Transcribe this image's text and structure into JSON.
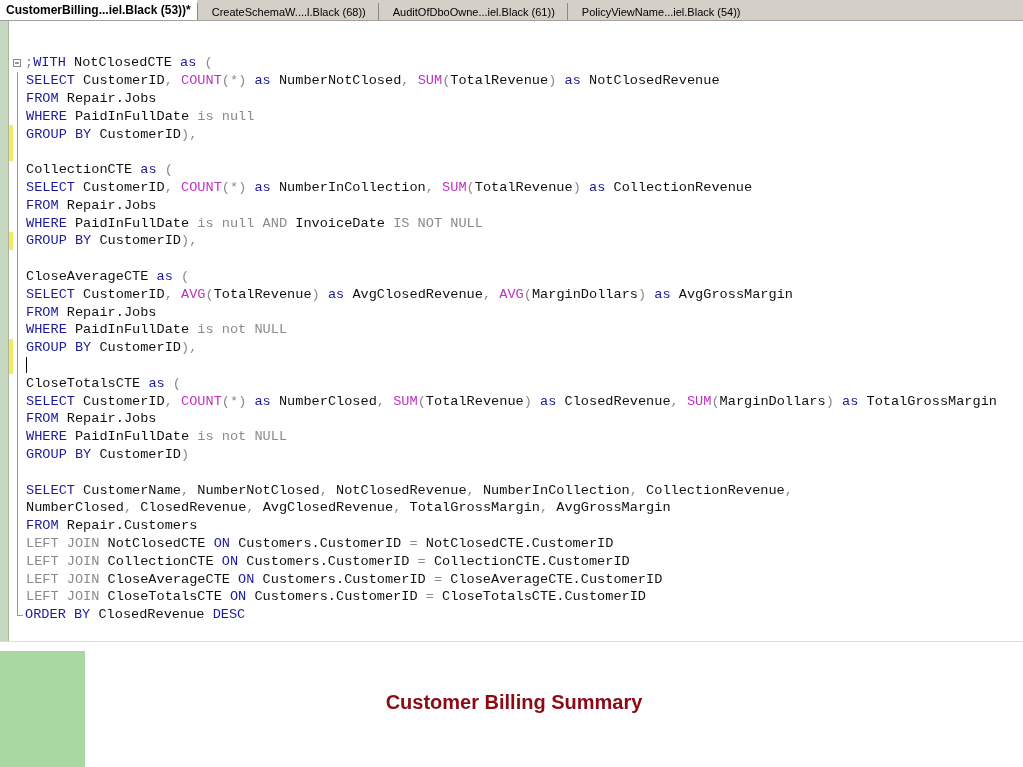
{
  "tabs": [
    {
      "label": "CustomerBilling...iel.Black (53))*",
      "selected": true
    },
    {
      "label": "CreateSchemaW....l.Black (68))",
      "selected": false
    },
    {
      "label": "AuditOfDboOwne...iel.Black (61))",
      "selected": false
    },
    {
      "label": "PolicyViewName...iel.Black (54))",
      "selected": false
    }
  ],
  "editor": {
    "lines": [
      {
        "tokens": [
          {
            "kind": "op",
            "text": ";"
          },
          {
            "kind": "kw",
            "text": "WITH"
          },
          {
            "kind": "plain",
            "text": " NotClosedCTE "
          },
          {
            "kind": "kw",
            "text": "as"
          },
          {
            "kind": "op",
            "text": " ("
          }
        ],
        "changed": false,
        "cursor": false
      },
      {
        "tokens": [
          {
            "kind": "kw",
            "text": "SELECT"
          },
          {
            "kind": "plain",
            "text": " CustomerID"
          },
          {
            "kind": "op",
            "text": ", "
          },
          {
            "kind": "fn",
            "text": "COUNT"
          },
          {
            "kind": "op",
            "text": "(*) "
          },
          {
            "kind": "kw",
            "text": "as"
          },
          {
            "kind": "plain",
            "text": " NumberNotClosed"
          },
          {
            "kind": "op",
            "text": ", "
          },
          {
            "kind": "fn",
            "text": "SUM"
          },
          {
            "kind": "op",
            "text": "("
          },
          {
            "kind": "plain",
            "text": "TotalRevenue"
          },
          {
            "kind": "op",
            "text": ") "
          },
          {
            "kind": "kw",
            "text": "as"
          },
          {
            "kind": "plain",
            "text": " NotClosedRevenue"
          }
        ],
        "changed": false,
        "cursor": false
      },
      {
        "tokens": [
          {
            "kind": "kw",
            "text": "FROM"
          },
          {
            "kind": "plain",
            "text": " Repair.Jobs"
          }
        ],
        "changed": false,
        "cursor": false
      },
      {
        "tokens": [
          {
            "kind": "kw",
            "text": "WHERE"
          },
          {
            "kind": "plain",
            "text": " PaidInFullDate "
          },
          {
            "kind": "op",
            "text": "is null"
          }
        ],
        "changed": false,
        "cursor": false
      },
      {
        "tokens": [
          {
            "kind": "kw",
            "text": "GROUP BY"
          },
          {
            "kind": "plain",
            "text": " CustomerID"
          },
          {
            "kind": "op",
            "text": "),"
          }
        ],
        "changed": true,
        "cursor": false
      },
      {
        "changed": true,
        "cursor": false
      },
      {
        "tokens": [
          {
            "kind": "plain",
            "text": "CollectionCTE "
          },
          {
            "kind": "kw",
            "text": "as"
          },
          {
            "kind": "op",
            "text": " ("
          }
        ],
        "changed": false,
        "cursor": false
      },
      {
        "tokens": [
          {
            "kind": "kw",
            "text": "SELECT"
          },
          {
            "kind": "plain",
            "text": " CustomerID"
          },
          {
            "kind": "op",
            "text": ", "
          },
          {
            "kind": "fn",
            "text": "COUNT"
          },
          {
            "kind": "op",
            "text": "(*) "
          },
          {
            "kind": "kw",
            "text": "as"
          },
          {
            "kind": "plain",
            "text": " NumberInCollection"
          },
          {
            "kind": "op",
            "text": ", "
          },
          {
            "kind": "fn",
            "text": "SUM"
          },
          {
            "kind": "op",
            "text": "("
          },
          {
            "kind": "plain",
            "text": "TotalRevenue"
          },
          {
            "kind": "op",
            "text": ") "
          },
          {
            "kind": "kw",
            "text": "as"
          },
          {
            "kind": "plain",
            "text": " CollectionRevenue"
          }
        ],
        "changed": false,
        "cursor": false
      },
      {
        "tokens": [
          {
            "kind": "kw",
            "text": "FROM"
          },
          {
            "kind": "plain",
            "text": " Repair.Jobs"
          }
        ],
        "changed": false,
        "cursor": false
      },
      {
        "tokens": [
          {
            "kind": "kw",
            "text": "WHERE"
          },
          {
            "kind": "plain",
            "text": " PaidInFullDate "
          },
          {
            "kind": "op",
            "text": "is null AND"
          },
          {
            "kind": "plain",
            "text": " InvoiceDate "
          },
          {
            "kind": "op",
            "text": "IS NOT NULL"
          }
        ],
        "changed": false,
        "cursor": false
      },
      {
        "tokens": [
          {
            "kind": "kw",
            "text": "GROUP BY"
          },
          {
            "kind": "plain",
            "text": " CustomerID"
          },
          {
            "kind": "op",
            "text": "),"
          }
        ],
        "changed": true,
        "cursor": false
      },
      {
        "changed": false,
        "cursor": false
      },
      {
        "tokens": [
          {
            "kind": "plain",
            "text": "CloseAverageCTE "
          },
          {
            "kind": "kw",
            "text": "as"
          },
          {
            "kind": "op",
            "text": " ("
          }
        ],
        "changed": false,
        "cursor": false
      },
      {
        "tokens": [
          {
            "kind": "kw",
            "text": "SELECT"
          },
          {
            "kind": "plain",
            "text": " CustomerID"
          },
          {
            "kind": "op",
            "text": ", "
          },
          {
            "kind": "fn",
            "text": "AVG"
          },
          {
            "kind": "op",
            "text": "("
          },
          {
            "kind": "plain",
            "text": "TotalRevenue"
          },
          {
            "kind": "op",
            "text": ") "
          },
          {
            "kind": "kw",
            "text": "as"
          },
          {
            "kind": "plain",
            "text": " AvgClosedRevenue"
          },
          {
            "kind": "op",
            "text": ", "
          },
          {
            "kind": "fn",
            "text": "AVG"
          },
          {
            "kind": "op",
            "text": "("
          },
          {
            "kind": "plain",
            "text": "MarginDollars"
          },
          {
            "kind": "op",
            "text": ") "
          },
          {
            "kind": "kw",
            "text": "as"
          },
          {
            "kind": "plain",
            "text": " AvgGrossMargin"
          }
        ],
        "changed": false,
        "cursor": false
      },
      {
        "tokens": [
          {
            "kind": "kw",
            "text": "FROM"
          },
          {
            "kind": "plain",
            "text": " Repair.Jobs"
          }
        ],
        "changed": false,
        "cursor": false
      },
      {
        "tokens": [
          {
            "kind": "kw",
            "text": "WHERE"
          },
          {
            "kind": "plain",
            "text": " PaidInFullDate "
          },
          {
            "kind": "op",
            "text": "is not NULL"
          }
        ],
        "changed": false,
        "cursor": false
      },
      {
        "tokens": [
          {
            "kind": "kw",
            "text": "GROUP BY"
          },
          {
            "kind": "plain",
            "text": " CustomerID"
          },
          {
            "kind": "op",
            "text": "),"
          }
        ],
        "changed": true,
        "cursor": false
      },
      {
        "changed": true,
        "cursor": true
      },
      {
        "tokens": [
          {
            "kind": "plain",
            "text": "CloseTotalsCTE "
          },
          {
            "kind": "kw",
            "text": "as"
          },
          {
            "kind": "op",
            "text": " ("
          }
        ],
        "changed": false,
        "cursor": false
      },
      {
        "tokens": [
          {
            "kind": "kw",
            "text": "SELECT"
          },
          {
            "kind": "plain",
            "text": " CustomerID"
          },
          {
            "kind": "op",
            "text": ", "
          },
          {
            "kind": "fn",
            "text": "COUNT"
          },
          {
            "kind": "op",
            "text": "(*) "
          },
          {
            "kind": "kw",
            "text": "as"
          },
          {
            "kind": "plain",
            "text": " NumberClosed"
          },
          {
            "kind": "op",
            "text": ", "
          },
          {
            "kind": "fn",
            "text": "SUM"
          },
          {
            "kind": "op",
            "text": "("
          },
          {
            "kind": "plain",
            "text": "TotalRevenue"
          },
          {
            "kind": "op",
            "text": ") "
          },
          {
            "kind": "kw",
            "text": "as"
          },
          {
            "kind": "plain",
            "text": " ClosedRevenue"
          },
          {
            "kind": "op",
            "text": ", "
          },
          {
            "kind": "fn",
            "text": "SUM"
          },
          {
            "kind": "op",
            "text": "("
          },
          {
            "kind": "plain",
            "text": "MarginDollars"
          },
          {
            "kind": "op",
            "text": ") "
          },
          {
            "kind": "kw",
            "text": "as"
          },
          {
            "kind": "plain",
            "text": " TotalGrossMargin"
          }
        ],
        "changed": false,
        "cursor": false
      },
      {
        "tokens": [
          {
            "kind": "kw",
            "text": "FROM"
          },
          {
            "kind": "plain",
            "text": " Repair.Jobs"
          }
        ],
        "changed": false,
        "cursor": false
      },
      {
        "tokens": [
          {
            "kind": "kw",
            "text": "WHERE"
          },
          {
            "kind": "plain",
            "text": " PaidInFullDate "
          },
          {
            "kind": "op",
            "text": "is not NULL"
          }
        ],
        "changed": false,
        "cursor": false
      },
      {
        "tokens": [
          {
            "kind": "kw",
            "text": "GROUP BY"
          },
          {
            "kind": "plain",
            "text": " CustomerID"
          },
          {
            "kind": "op",
            "text": ")"
          }
        ],
        "changed": false,
        "cursor": false
      },
      {
        "changed": false,
        "cursor": false
      },
      {
        "tokens": [
          {
            "kind": "kw",
            "text": "SELECT"
          },
          {
            "kind": "plain",
            "text": " CustomerName"
          },
          {
            "kind": "op",
            "text": ", "
          },
          {
            "kind": "plain",
            "text": "NumberNotClosed"
          },
          {
            "kind": "op",
            "text": ", "
          },
          {
            "kind": "plain",
            "text": "NotClosedRevenue"
          },
          {
            "kind": "op",
            "text": ", "
          },
          {
            "kind": "plain",
            "text": "NumberInCollection"
          },
          {
            "kind": "op",
            "text": ", "
          },
          {
            "kind": "plain",
            "text": "CollectionRevenue"
          },
          {
            "kind": "op",
            "text": ","
          }
        ],
        "changed": false,
        "cursor": false
      },
      {
        "tokens": [
          {
            "kind": "plain",
            "text": "NumberClosed"
          },
          {
            "kind": "op",
            "text": ", "
          },
          {
            "kind": "plain",
            "text": "ClosedRevenue"
          },
          {
            "kind": "op",
            "text": ", "
          },
          {
            "kind": "plain",
            "text": "AvgClosedRevenue"
          },
          {
            "kind": "op",
            "text": ", "
          },
          {
            "kind": "plain",
            "text": "TotalGrossMargin"
          },
          {
            "kind": "op",
            "text": ", "
          },
          {
            "kind": "plain",
            "text": "AvgGrossMargin"
          }
        ],
        "changed": false,
        "cursor": false
      },
      {
        "tokens": [
          {
            "kind": "kw",
            "text": "FROM"
          },
          {
            "kind": "plain",
            "text": " Repair.Customers"
          }
        ],
        "changed": false,
        "cursor": false
      },
      {
        "tokens": [
          {
            "kind": "op",
            "text": "LEFT JOIN"
          },
          {
            "kind": "plain",
            "text": " NotClosedCTE "
          },
          {
            "kind": "kw",
            "text": "ON"
          },
          {
            "kind": "plain",
            "text": " Customers.CustomerID "
          },
          {
            "kind": "op",
            "text": "="
          },
          {
            "kind": "plain",
            "text": " NotClosedCTE.CustomerID"
          }
        ],
        "changed": false,
        "cursor": false
      },
      {
        "tokens": [
          {
            "kind": "op",
            "text": "LEFT JOIN"
          },
          {
            "kind": "plain",
            "text": " CollectionCTE "
          },
          {
            "kind": "kw",
            "text": "ON"
          },
          {
            "kind": "plain",
            "text": " Customers.CustomerID "
          },
          {
            "kind": "op",
            "text": "="
          },
          {
            "kind": "plain",
            "text": " CollectionCTE.CustomerID"
          }
        ],
        "changed": false,
        "cursor": false
      },
      {
        "tokens": [
          {
            "kind": "op",
            "text": "LEFT JOIN"
          },
          {
            "kind": "plain",
            "text": " CloseAverageCTE "
          },
          {
            "kind": "kw",
            "text": "ON"
          },
          {
            "kind": "plain",
            "text": " Customers.CustomerID "
          },
          {
            "kind": "op",
            "text": "="
          },
          {
            "kind": "plain",
            "text": " CloseAverageCTE.CustomerID"
          }
        ],
        "changed": false,
        "cursor": false
      },
      {
        "tokens": [
          {
            "kind": "op",
            "text": "LEFT JOIN"
          },
          {
            "kind": "plain",
            "text": " CloseTotalsCTE "
          },
          {
            "kind": "kw",
            "text": "ON"
          },
          {
            "kind": "plain",
            "text": " Customers.CustomerID "
          },
          {
            "kind": "op",
            "text": "="
          },
          {
            "kind": "plain",
            "text": " CloseTotalsCTE.CustomerID"
          }
        ],
        "changed": false,
        "cursor": false
      },
      {
        "tokens": [
          {
            "kind": "kw",
            "text": "ORDER BY"
          },
          {
            "kind": "plain",
            "text": " ClosedRevenue "
          },
          {
            "kind": "kw",
            "text": "DESC"
          }
        ],
        "changed": false,
        "cursor": false
      }
    ]
  },
  "caption": "Customer Billing Summary"
}
